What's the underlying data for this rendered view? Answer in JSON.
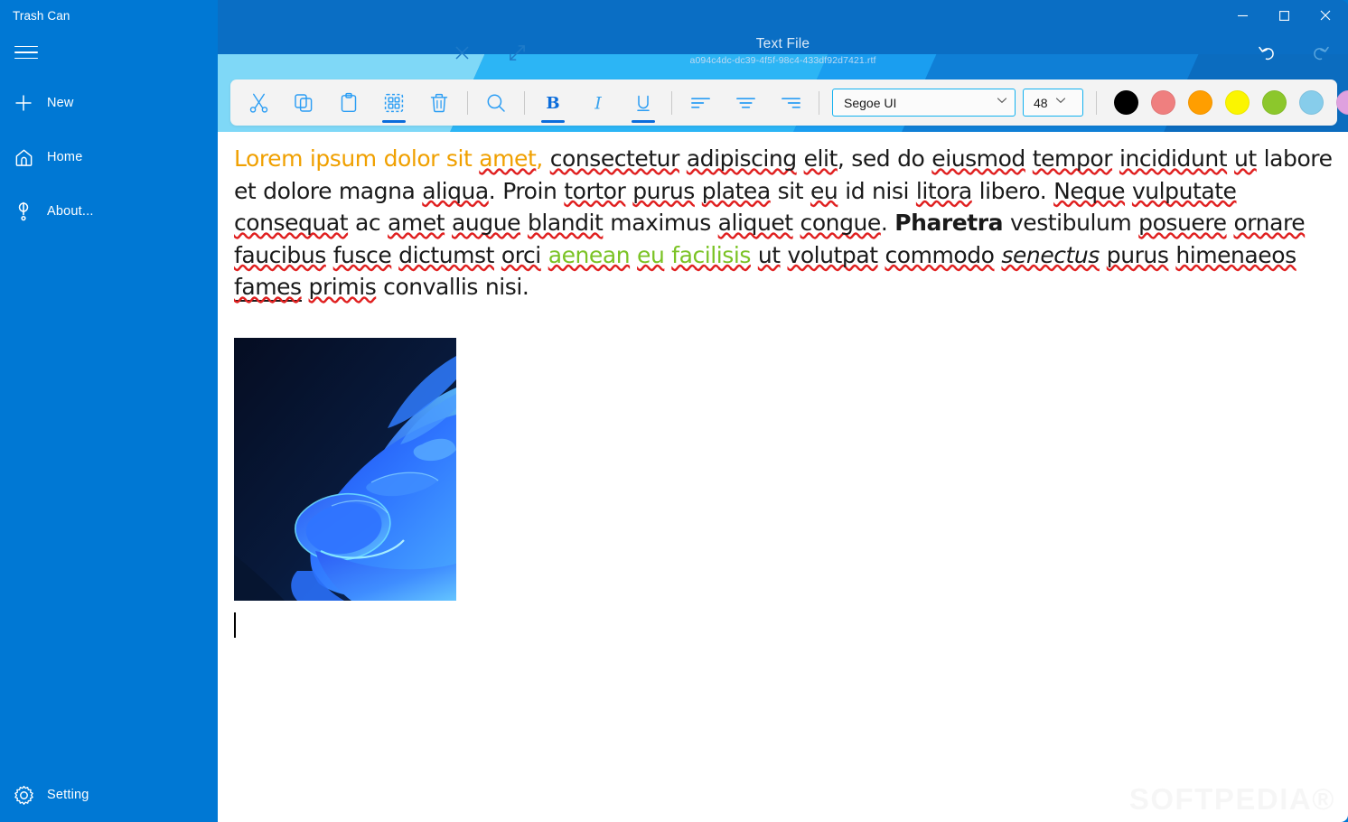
{
  "sidebar": {
    "title": "Trash Can",
    "menu_icon": "hamburger-icon",
    "items": [
      {
        "id": "new",
        "label": "New",
        "icon": "plus-icon"
      },
      {
        "id": "home",
        "label": "Home",
        "icon": "home-icon"
      },
      {
        "id": "about",
        "label": "About...",
        "icon": "info-icon"
      },
      {
        "id": "setting",
        "label": "Setting",
        "icon": "gear-icon"
      }
    ]
  },
  "window": {
    "minimize_label": "─",
    "maximize_label": "☐",
    "close_label": "✕",
    "undo_icon": "undo-icon",
    "redo_icon": "redo-icon",
    "doc_close_icon": "close-icon",
    "doc_expand_icon": "expand-icon"
  },
  "document": {
    "title": "Text File",
    "subtitle": "a094c4dc-dc39-4f5f-98c4-433df92d7421.rtf"
  },
  "toolbar": {
    "buttons": [
      {
        "id": "cut",
        "label": "Cut",
        "icon": "scissors-icon",
        "active": false
      },
      {
        "id": "copy",
        "label": "Copy",
        "icon": "copy-icon",
        "active": false
      },
      {
        "id": "paste",
        "label": "Paste",
        "icon": "clipboard-icon",
        "active": false
      },
      {
        "id": "select-all",
        "label": "Select All",
        "icon": "select-all-icon",
        "active": true
      },
      {
        "id": "delete",
        "label": "Delete",
        "icon": "trash-icon",
        "active": false
      },
      {
        "id": "search",
        "label": "Search",
        "icon": "search-icon",
        "active": false
      },
      {
        "id": "bold",
        "label": "Bold",
        "icon": "bold-icon",
        "active": true
      },
      {
        "id": "italic",
        "label": "Italic",
        "icon": "italic-icon",
        "active": false
      },
      {
        "id": "underline",
        "label": "Underline",
        "icon": "underline-icon",
        "active": true
      },
      {
        "id": "align-left",
        "label": "Align Left",
        "icon": "align-left-icon",
        "active": false
      },
      {
        "id": "align-center",
        "label": "Align Center",
        "icon": "align-center-icon",
        "active": false
      },
      {
        "id": "align-right",
        "label": "Align Right",
        "icon": "align-right-icon",
        "active": false
      }
    ],
    "font_family": {
      "value": "Segoe UI",
      "placeholder": "Segoe UI"
    },
    "font_size": {
      "value": "48",
      "placeholder": "48"
    },
    "colors": [
      {
        "id": "black",
        "hex": "#000000"
      },
      {
        "id": "salmon",
        "hex": "#ef7f7f"
      },
      {
        "id": "orange",
        "hex": "#ff9e00"
      },
      {
        "id": "yellow",
        "hex": "#fbf500"
      },
      {
        "id": "green",
        "hex": "#8cc72c"
      },
      {
        "id": "sky",
        "hex": "#87cdeb"
      },
      {
        "id": "violet",
        "hex": "#dfa1df"
      }
    ]
  },
  "content": {
    "colors": {
      "orange": "#f0a000",
      "green": "#7bc325"
    },
    "runs": [
      {
        "t": "Lorem ipsum dolor sit ",
        "color": "orange"
      },
      {
        "t": "amet",
        "color": "orange",
        "spell": true
      },
      {
        "t": ", ",
        "color": "orange"
      },
      {
        "t": "consectetur",
        "spell": true
      },
      {
        "t": " "
      },
      {
        "t": "adipiscing",
        "spell": true
      },
      {
        "t": " "
      },
      {
        "t": "elit",
        "spell": true
      },
      {
        "t": ", sed do "
      },
      {
        "t": "eiusmod",
        "spell": true
      },
      {
        "t": " "
      },
      {
        "t": "tempor",
        "spell": true
      },
      {
        "t": " "
      },
      {
        "t": "incididunt",
        "spell": true
      },
      {
        "t": " "
      },
      {
        "t": "ut",
        "spell": true
      },
      {
        "t": " labore et dolore magna "
      },
      {
        "t": "aliqua",
        "spell": true
      },
      {
        "t": ". Proin "
      },
      {
        "t": "tortor",
        "spell": true
      },
      {
        "t": " "
      },
      {
        "t": "purus",
        "spell": true
      },
      {
        "t": " "
      },
      {
        "t": "platea",
        "spell": true
      },
      {
        "t": " sit "
      },
      {
        "t": "eu",
        "spell": true
      },
      {
        "t": " id nisi "
      },
      {
        "t": "litora",
        "spell": true
      },
      {
        "t": " libero. "
      },
      {
        "t": "Neque",
        "spell": true
      },
      {
        "t": " "
      },
      {
        "t": "vulputate",
        "spell": true
      },
      {
        "t": " "
      },
      {
        "t": "consequat",
        "spell": true
      },
      {
        "t": " ac "
      },
      {
        "t": "amet",
        "spell": true
      },
      {
        "t": " "
      },
      {
        "t": "augue",
        "spell": true
      },
      {
        "t": " "
      },
      {
        "t": "blandit",
        "spell": true
      },
      {
        "t": " maximus "
      },
      {
        "t": "aliquet",
        "spell": true
      },
      {
        "t": " "
      },
      {
        "t": "congue",
        "spell": true
      },
      {
        "t": ". "
      },
      {
        "t": "Pharetra",
        "bold": true
      },
      {
        "t": " vestibulum "
      },
      {
        "t": "posuere",
        "spell": true
      },
      {
        "t": " "
      },
      {
        "t": "ornare",
        "spell": true
      },
      {
        "t": " "
      },
      {
        "t": "faucibus",
        "spell": true
      },
      {
        "t": " "
      },
      {
        "t": "fusce",
        "spell": true
      },
      {
        "t": " "
      },
      {
        "t": "dictumst",
        "spell": true
      },
      {
        "t": " "
      },
      {
        "t": "orci",
        "spell": true
      },
      {
        "t": " "
      },
      {
        "t": "aenean",
        "color": "green",
        "spell": true
      },
      {
        "t": " ",
        "color": "green"
      },
      {
        "t": "eu",
        "color": "green",
        "spell": true
      },
      {
        "t": " ",
        "color": "green"
      },
      {
        "t": "facilisis",
        "color": "green",
        "spell": true
      },
      {
        "t": " "
      },
      {
        "t": "ut",
        "spell": true
      },
      {
        "t": " "
      },
      {
        "t": "volutpat",
        "spell": true
      },
      {
        "t": " "
      },
      {
        "t": "commodo",
        "spell": true
      },
      {
        "t": " "
      },
      {
        "t": "senectus",
        "italic": true,
        "spell": true
      },
      {
        "t": " "
      },
      {
        "t": "purus",
        "spell": true
      },
      {
        "t": " "
      },
      {
        "t": "himenaeos",
        "spell": true
      },
      {
        "t": " "
      },
      {
        "t": "fames",
        "underline": true,
        "spell": true
      },
      {
        "t": " "
      },
      {
        "t": "primis",
        "spell": true
      },
      {
        "t": " convallis nisi."
      }
    ],
    "image_alt": "windows-bloom-wallpaper-thumbnail",
    "caret_visible": true
  },
  "watermark": "SOFTPEDIA®"
}
